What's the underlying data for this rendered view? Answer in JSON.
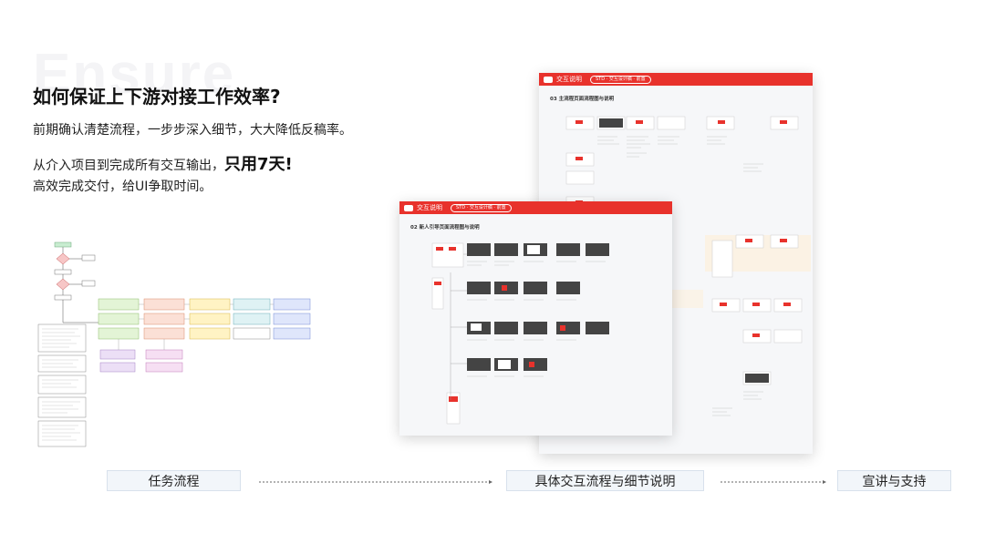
{
  "watermark": "Ensure",
  "heading": "如何保证上下游对接工作效率?",
  "subtitle": "前期确认清楚流程，一步步深入细节，大大降低反稿率。",
  "line2_prefix": "从介入项目到完成所有交互输出，",
  "line2_highlight": "只用7天!",
  "line3": "高效完成交付，给UI争取时间。",
  "board_front": {
    "app_name": "交互说明",
    "pill": "STD · 交互设计稿 · 前置",
    "section": "02 新人引导页面流程图与说明"
  },
  "board_back": {
    "app_name": "交互说明",
    "pill": "STD · 交互设计稿 · 前置",
    "section": "03 主流程页面流程图与说明"
  },
  "steps": [
    "任务流程",
    "具体交互流程与细节说明",
    "宣讲与支持"
  ],
  "colors": {
    "brand_red": "#e8322c",
    "step_bg": "#f2f6fa",
    "step_border": "#d8e1ec"
  }
}
